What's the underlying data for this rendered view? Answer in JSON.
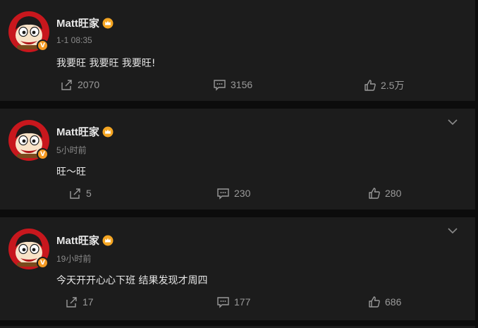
{
  "feed": {
    "posts": [
      {
        "username": "Matt旺家",
        "time": "1-1 08:35",
        "text": "我要旺 我要旺 我要旺!",
        "repost_count": "2070",
        "comment_count": "3156",
        "like_count": "2.5万",
        "show_chevron": false
      },
      {
        "username": "Matt旺家",
        "time": "5小时前",
        "text": "旺～旺",
        "repost_count": "5",
        "comment_count": "230",
        "like_count": "280",
        "show_chevron": true
      },
      {
        "username": "Matt旺家",
        "time": "19小时前",
        "text": "今天开开心心下班 结果发现才周四",
        "repost_count": "17",
        "comment_count": "177",
        "like_count": "686",
        "show_chevron": true
      }
    ],
    "verified_badge": "V",
    "icons": {
      "avatar": "cartoon-boy-avatar",
      "verified": "verified-v-badge",
      "member": "gold-crown-member-icon",
      "repost": "share-arrow-icon",
      "comment": "comment-bubble-icon",
      "like": "thumbs-up-icon",
      "more": "chevron-down-icon"
    },
    "colors": {
      "background": "#0c0c0c",
      "card": "#1c1c1c",
      "text": "#e6e6e6",
      "muted": "#8a8a8a",
      "badge": "#f59a23"
    }
  }
}
